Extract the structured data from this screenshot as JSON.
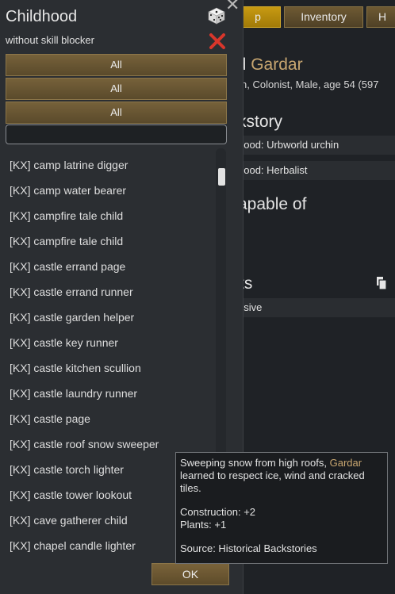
{
  "background_window": {
    "tabs": [
      {
        "label": "p",
        "active": true
      },
      {
        "label": "Inventory",
        "active": false
      },
      {
        "label": "H",
        "active": false
      }
    ],
    "pawn_name_prefix": "id",
    "pawn_name": "Gardar",
    "pawn_description": "n, Colonist, Male, age 54 (597",
    "backstory_heading": "kstory",
    "childhood_row": "hood: Urbworld urchin",
    "adulthood_row": "hood: Herbalist",
    "incapable_heading": "apable of",
    "traits_heading": "ts",
    "trait_row": "nsive"
  },
  "dialog": {
    "title": "Childhood",
    "subtitle": "without skill blocker",
    "close_symbol": "✕",
    "filters": [
      "All",
      "All",
      "All"
    ],
    "search": {
      "value": "",
      "placeholder": ""
    },
    "items": [
      "[KX] camp latrine digger",
      "[KX] camp water bearer",
      "[KX] campfire tale child",
      "[KX] campfire tale child",
      "[KX] castle errand page",
      "[KX] castle errand runner",
      "[KX] castle garden helper",
      "[KX] castle key runner",
      "[KX] castle kitchen scullion",
      "[KX] castle laundry runner",
      "[KX] castle page",
      "[KX] castle roof snow sweeper",
      "[KX] castle torch lighter",
      "[KX] castle tower lookout",
      "[KX] cave gatherer child",
      "[KX] chapel candle lighter"
    ],
    "ok_label": "OK"
  },
  "tooltip": {
    "line1_prefix": "Sweeping snow from high roofs, ",
    "pawn_name": "Gardar",
    "line1_suffix": "learned to respect ice, wind and cracked tiles.",
    "skills": [
      "Construction: +2",
      "Plants: +1"
    ],
    "source": "Source: Historical Backstories"
  },
  "colors": {
    "accent_gold": "#c8a670",
    "active_tab": "#c79a12",
    "button_brown": "#76613a",
    "close_red": "#d9362b"
  }
}
